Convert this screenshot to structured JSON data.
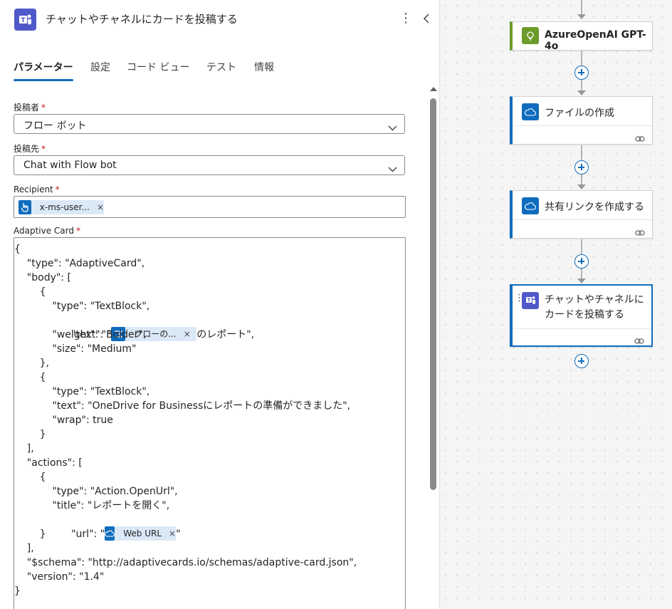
{
  "panel": {
    "title": "チャットやチャネルにカードを投稿する",
    "app_icon": "teams-icon",
    "more_icon": "more-vertical-icon",
    "collapse_icon": "chevron-left-icon",
    "tabs": [
      {
        "label": "パラメーター",
        "active": true
      },
      {
        "label": "設定"
      },
      {
        "label": "コード ビュー"
      },
      {
        "label": "テスト"
      },
      {
        "label": "情報"
      }
    ],
    "fields": {
      "poster": {
        "label": "投稿者",
        "required": "*",
        "value": "フロー ボット"
      },
      "post_in": {
        "label": "投稿先",
        "required": "*",
        "value": "Chat with Flow bot"
      },
      "recipient": {
        "label": "Recipient",
        "required": "*",
        "token": "x-ms-user...",
        "remove": "×"
      },
      "adaptive_card": {
        "label": "Adaptive Card",
        "required": "*"
      }
    },
    "code": {
      "l1": "{",
      "l2": "    \"type\": \"AdaptiveCard\",",
      "l3": "    \"body\": [",
      "l4": "        {",
      "l5": "            \"type\": \"TextBlock\",",
      "l6_pre": "            \"text\": \"",
      "l6_token": "フローの...",
      "l6_post": "のレポート\",",
      "l7": "            \"weight\": \"Bolder\",",
      "l8": "            \"size\": \"Medium\"",
      "l9": "        },",
      "l10": "        {",
      "l11": "            \"type\": \"TextBlock\",",
      "l12": "            \"text\": \"OneDrive for Businessにレポートの準備ができました\",",
      "l13": "            \"wrap\": true",
      "l14": "        }",
      "l15": "    ],",
      "l16": "    \"actions\": [",
      "l17": "        {",
      "l18": "            \"type\": \"Action.OpenUrl\",",
      "l19": "            \"title\": \"レポートを開く\",",
      "l20_pre": "            \"url\": \"",
      "l20_token": "Web URL",
      "l20_post": "\"",
      "l21": "        }",
      "l22": "    ],",
      "l23": "    \"$schema\": \"http://adaptivecards.io/schemas/adaptive-card.json\",",
      "l24": "    \"version\": \"1.4\"",
      "l25": "}",
      "remove": "×"
    }
  },
  "flow": {
    "cards": [
      {
        "title": "AzureOpenAI GPT-4o",
        "icon": "azure-openai-icon",
        "accent": "#6b9a2a"
      },
      {
        "title": "ファイルの作成",
        "icon": "onedrive-icon",
        "accent": "#0f6cbd"
      },
      {
        "title": "共有リンクを作成する",
        "icon": "onedrive-icon",
        "accent": "#0f6cbd"
      },
      {
        "title_line1": "チャットやチャネルに",
        "title_line2": "カードを投稿する",
        "icon": "teams-icon",
        "accent": "#0f6cbd",
        "selected": true
      }
    ]
  },
  "colors": {
    "accent": "#0f6cbd",
    "teams": "#5059c9",
    "azure_openai": "#6b9a2a",
    "token_bg": "#dbe9f7",
    "required": "#c50f1f"
  }
}
